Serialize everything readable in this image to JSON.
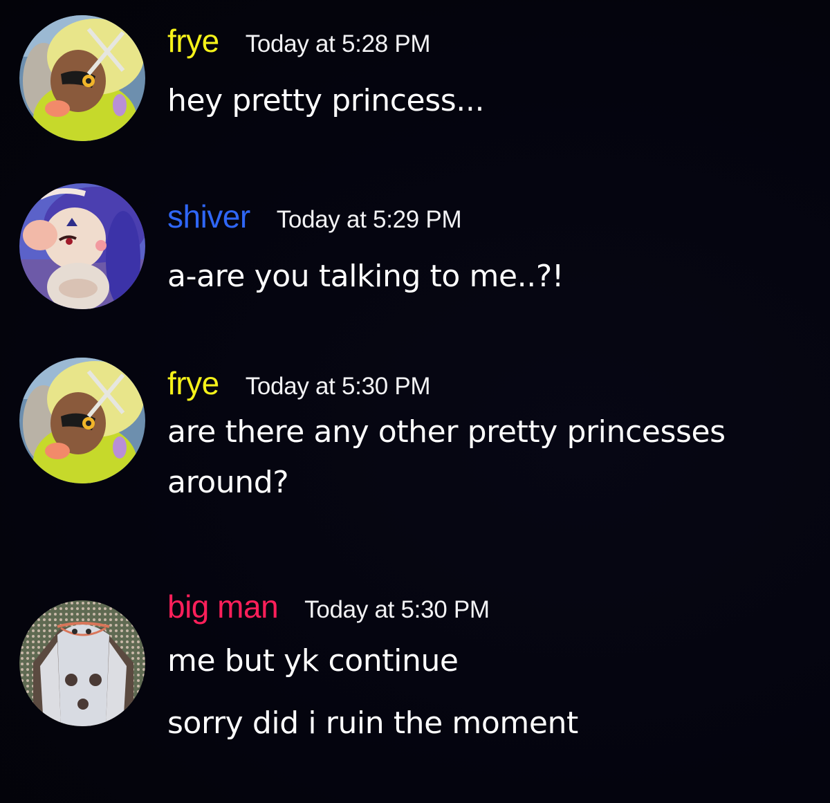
{
  "colors": {
    "background": "#04040f",
    "frye": "#f5f21a",
    "shiver": "#2f66f5",
    "big_man": "#ff1f5a",
    "timestamp": "#f2f2f4",
    "text": "#ffffff"
  },
  "messages": [
    {
      "username": "frye",
      "timestamp": "Today at 5:28 PM",
      "avatar": "frye-avatar",
      "lines": [
        "hey pretty princess..."
      ]
    },
    {
      "username": "shiver",
      "timestamp": "Today at 5:29 PM",
      "avatar": "shiver-avatar",
      "lines": [
        "a-are you talking to me..?!"
      ]
    },
    {
      "username": "frye",
      "timestamp": "Today at 5:30 PM",
      "avatar": "frye-avatar",
      "lines": [
        "are there any other pretty princesses",
        "around?"
      ]
    },
    {
      "username": "big man",
      "timestamp": "Today at 5:30 PM",
      "avatar": "big-man-avatar",
      "lines": [
        "me but yk continue",
        "sorry did i ruin the moment"
      ]
    }
  ]
}
